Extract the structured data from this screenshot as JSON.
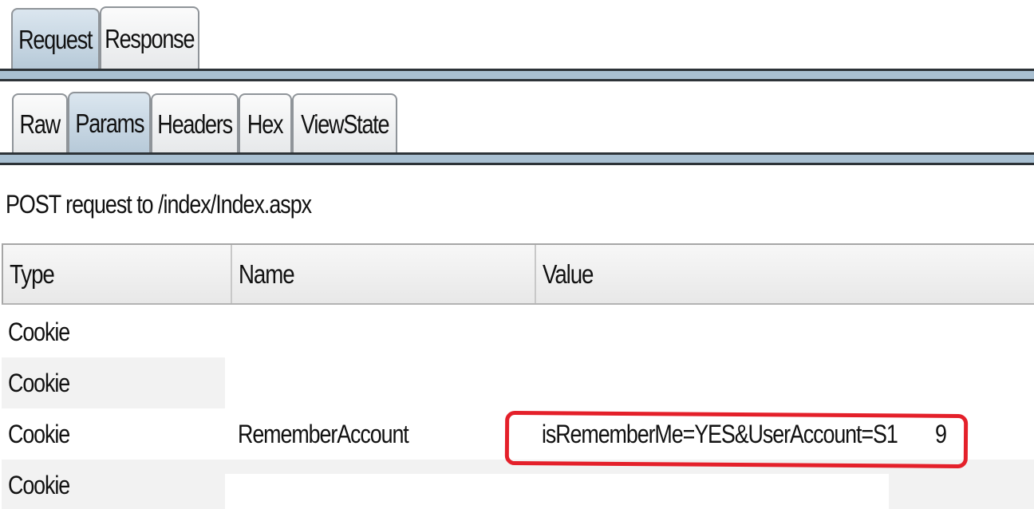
{
  "top_tabs": [
    {
      "label": "Request",
      "active": true
    },
    {
      "label": "Response",
      "active": false
    }
  ],
  "sub_tabs": [
    {
      "label": "Raw",
      "active": false
    },
    {
      "label": "Params",
      "active": true
    },
    {
      "label": "Headers",
      "active": false
    },
    {
      "label": "Hex",
      "active": false
    },
    {
      "label": "ViewState",
      "active": false
    }
  ],
  "request_summary": "POST request to /index/Index.aspx",
  "table": {
    "headers": [
      "Type",
      "Name",
      "Value"
    ],
    "rows": [
      {
        "type": "Cookie",
        "name": "",
        "value": ""
      },
      {
        "type": "Cookie",
        "name": "",
        "value": ""
      },
      {
        "type": "Cookie",
        "name": "RememberAccount",
        "value": "isRememberMe=YES&UserAccount=S1",
        "value_suffix": "9"
      },
      {
        "type": "Cookie",
        "name": "",
        "value": ""
      }
    ]
  },
  "colors": {
    "active_tab": "#b6c9d8",
    "annotation": "#e4202a"
  }
}
